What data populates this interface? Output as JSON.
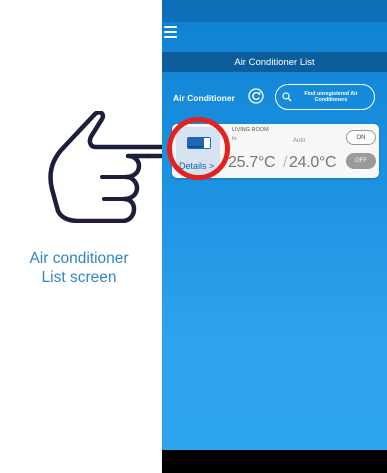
{
  "annotation": {
    "caption_line1": "Air conditioner",
    "caption_line2": "List screen"
  },
  "app": {
    "title": "Air Conditioner List",
    "section_label": "Air Conditioner",
    "find_button": {
      "line1": "Find unregistered Air",
      "line2": "Conditioners"
    }
  },
  "units": [
    {
      "room_name": "LIVING ROOM",
      "mode_label": "In",
      "room_temp": "25.7°C",
      "mode": "Auto",
      "set_temp": "24.0°C",
      "details_label": "Details >",
      "on_label": "ON",
      "off_label": "OFF"
    }
  ],
  "colors": {
    "accent": "#0b5d9c",
    "highlight": "#e5201d",
    "caption": "#2f86c9"
  },
  "icons": [
    "menu-icon",
    "refresh-icon",
    "search-icon",
    "air-conditioner-icon",
    "pointing-hand-icon"
  ]
}
